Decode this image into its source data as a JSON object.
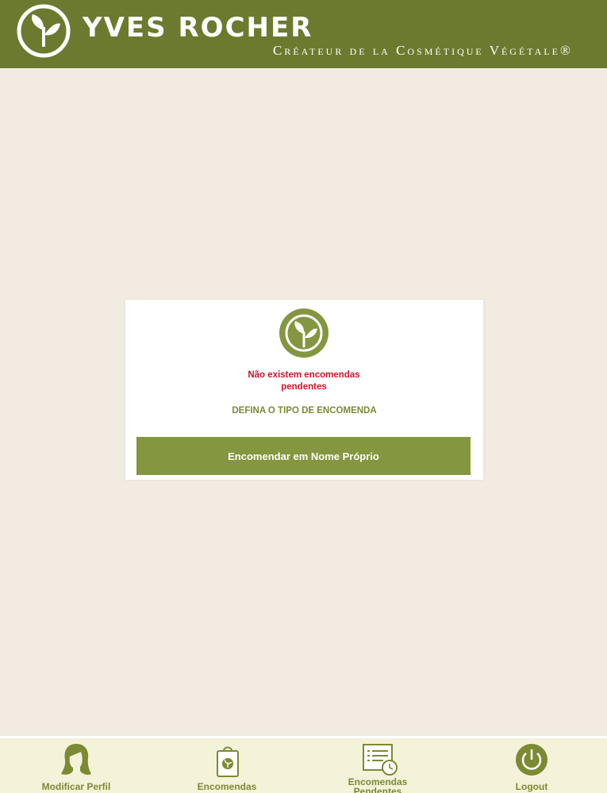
{
  "header": {
    "brand_name": "YVES ROCHER",
    "tagline": "Créateur de la Cosmétique Végétale®",
    "logo_icon": "leaf-logo-icon"
  },
  "modal": {
    "logo_icon": "leaf-logo-icon",
    "message": "Não existem encomendas pendentes",
    "subtitle": "DEFINA O TIPO DE ENCOMENDA",
    "button_label": "Encomendar em Nome Próprio"
  },
  "bottom_nav": {
    "items": [
      {
        "label": "Modificar Perfil",
        "icon": "woman-profile-icon"
      },
      {
        "label": "Encomendas",
        "icon": "shopping-bag-icon"
      },
      {
        "label": "Encomendas Pendentes",
        "icon": "pending-list-clock-icon"
      },
      {
        "label": "Logout",
        "icon": "power-icon"
      }
    ]
  },
  "colors": {
    "header_bg": "#6b7a2e",
    "page_bg": "#f1ebe1",
    "accent_green": "#84963f",
    "error_red": "#d0142c",
    "nav_bg": "#f5f2da"
  }
}
